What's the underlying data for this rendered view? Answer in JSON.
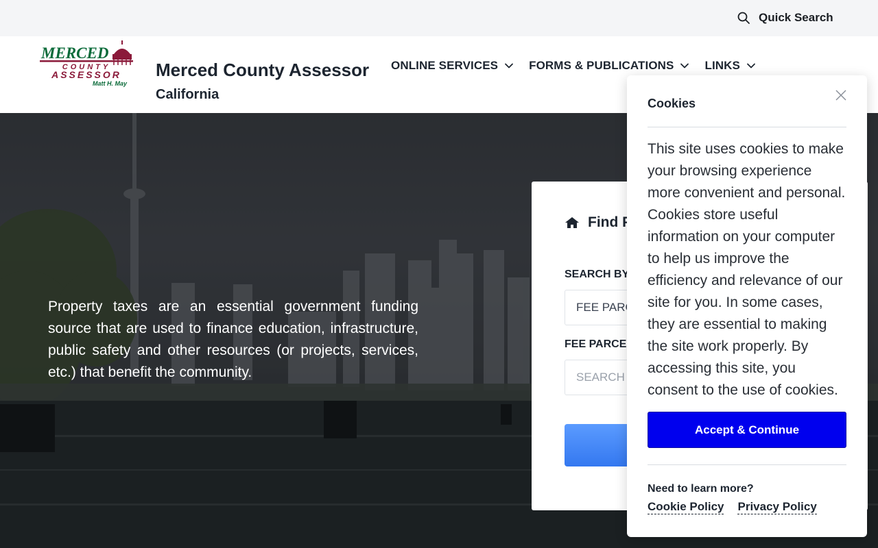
{
  "topbar": {
    "quick_search_label": "Quick Search",
    "quick_search_icon": "search-icon"
  },
  "header": {
    "logo": {
      "line1": "MERCED",
      "line2": "COUNTY",
      "line3": "ASSESSOR",
      "line4": "Matt H. May"
    },
    "title": "Merced County Assessor",
    "subtitle": "California",
    "nav": [
      {
        "label": "ONLINE SERVICES",
        "icon": "chevron-down-icon"
      },
      {
        "label": "FORMS & PUBLICATIONS",
        "icon": "chevron-down-icon"
      },
      {
        "label": "LINKS",
        "icon": "chevron-down-icon"
      }
    ]
  },
  "hero": {
    "text": "Property taxes are an essential government funding source that are used to finance education, infrastructure, public safety and other resources (or projects, services, etc.) that benefit the community."
  },
  "search_card": {
    "title": "Find P",
    "title_icon": "house-icon",
    "search_by_label": "SEARCH BY",
    "search_by_value": "FEE PARC",
    "fee_parcel_label": "FEE PARCEL",
    "fee_parcel_placeholder": "SEARCH T"
  },
  "cookie_dialog": {
    "title": "Cookies",
    "body": "This site uses cookies to make your browsing experience more convenient and personal. Cookies store useful information on your computer to help us improve the efficiency and relevance of our site for you. In some cases, they are essential to making the site work properly. By accessing this site, you consent to the use of cookies.",
    "accept_label": "Accept & Continue",
    "learn_more": "Need to learn more?",
    "cookie_policy": "Cookie Policy",
    "privacy_policy": "Privacy Policy"
  },
  "colors": {
    "accept_button": "#0000ee",
    "logo_green": "#0b6b3a",
    "logo_maroon": "#8b1a3a",
    "search_button": "#3f86f5"
  }
}
